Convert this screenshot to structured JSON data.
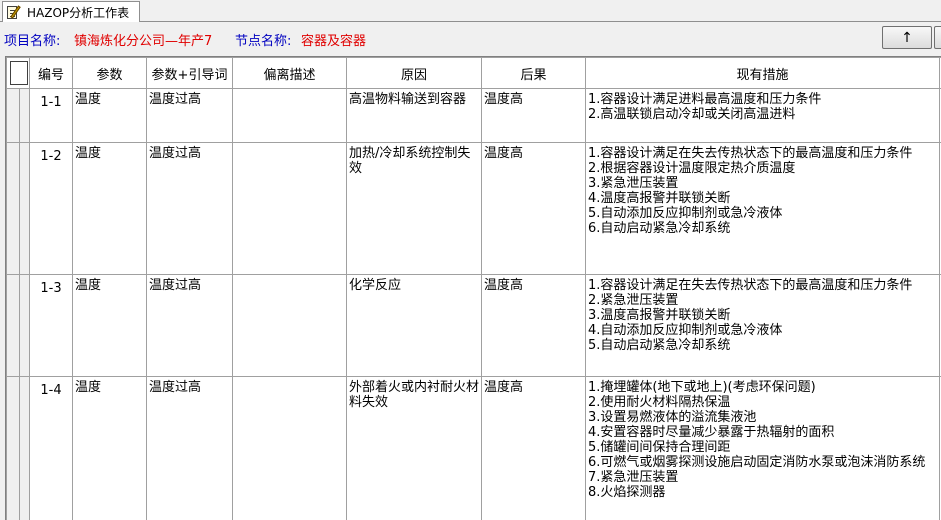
{
  "tab": {
    "title": "HAZOP分析工作表"
  },
  "info": {
    "project_label": "项目名称:",
    "project_value": "镇海炼化分公司—年产7",
    "node_label": "节点名称:",
    "node_value": "容器及容器"
  },
  "toolbar": {
    "up_label": "↑"
  },
  "columns": [
    "编号",
    "参数",
    "参数+引导词",
    "偏离描述",
    "原因",
    "后果",
    "现有措施"
  ],
  "rows": [
    {
      "id": "1-1",
      "param": "温度",
      "guide": "温度过高",
      "deviation": "",
      "cause": "高温物料输送到容器",
      "consequence": "温度高",
      "measures": [
        "1.容器设计满足进料最高温度和压力条件",
        "2.高温联锁启动冷却或关闭高温进料"
      ]
    },
    {
      "id": "1-2",
      "param": "温度",
      "guide": "温度过高",
      "deviation": "",
      "cause": "加热/冷却系统控制失效",
      "consequence": "温度高",
      "measures": [
        "1.容器设计满足在失去传热状态下的最高温度和压力条件",
        "2.根据容器设计温度限定热介质温度",
        "3.紧急泄压装置",
        "4.温度高报警并联锁关断",
        "5.自动添加反应抑制剂或急冷液体",
        "6.自动启动紧急冷却系统"
      ]
    },
    {
      "id": "1-3",
      "param": "温度",
      "guide": "温度过高",
      "deviation": "",
      "cause": "化学反应",
      "consequence": "温度高",
      "measures": [
        "1.容器设计满足在失去传热状态下的最高温度和压力条件",
        "2.紧急泄压装置",
        "3.温度高报警并联锁关断",
        "4.自动添加反应抑制剂或急冷液体",
        "5.自动启动紧急冷却系统"
      ]
    },
    {
      "id": "1-4",
      "param": "温度",
      "guide": "温度过高",
      "deviation": "",
      "cause": "外部着火或内衬耐火材料失效",
      "consequence": "温度高",
      "measures": [
        "1.掩埋罐体(地下或地上)(考虑环保问题)",
        "2.使用耐火材料隔热保温",
        "3.设置易燃液体的溢流集液池",
        "4.安置容器时尽量减少暴露于热辐射的面积",
        "5.储罐间间保持合理间距",
        "6.可燃气或烟雾探测设施启动固定消防水泵或泡沫消防系统",
        "7.紧急泄压装置",
        "8.火焰探测器"
      ]
    }
  ]
}
